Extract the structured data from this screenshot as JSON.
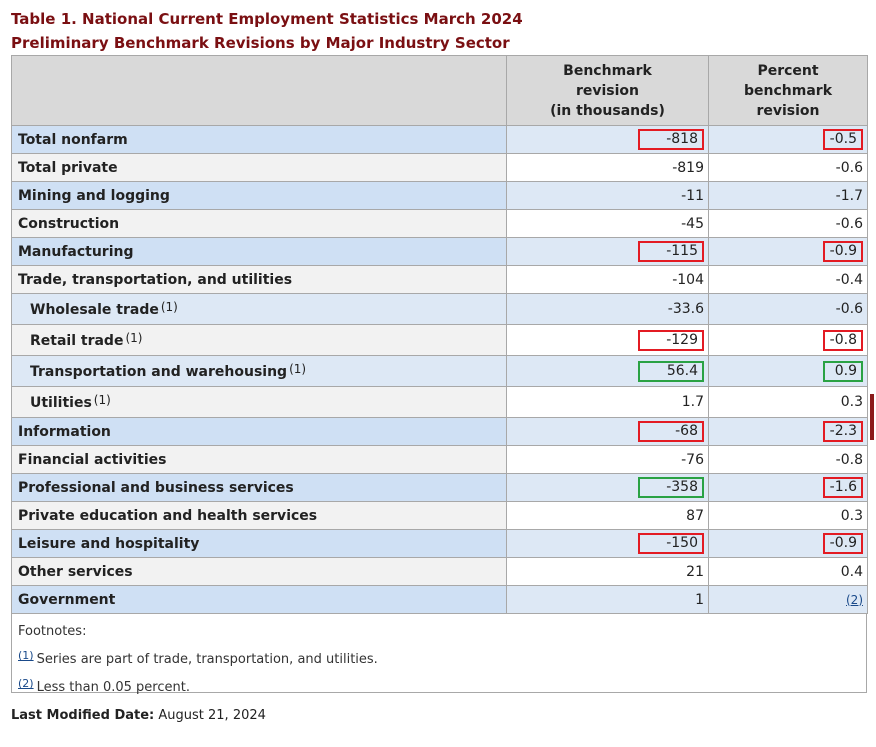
{
  "title": {
    "line1": "Table 1. National Current Employment Statistics March 2024",
    "line2": "Preliminary Benchmark Revisions by Major Industry Sector"
  },
  "columns": {
    "benchmark": [
      "Benchmark",
      "revision",
      "(in thousands)"
    ],
    "percent": [
      "Percent",
      "benchmark",
      "revision"
    ]
  },
  "rows": [
    {
      "label": "Total nonfarm",
      "benchmark": "-818",
      "percent": "-0.5",
      "bench_box": "red",
      "pct_box": "red"
    },
    {
      "label": "Total private",
      "benchmark": "-819",
      "percent": "-0.6"
    },
    {
      "label": "Mining and logging",
      "benchmark": "-11",
      "percent": "-1.7"
    },
    {
      "label": "Construction",
      "benchmark": "-45",
      "percent": "-0.6"
    },
    {
      "label": "Manufacturing",
      "benchmark": "-115",
      "percent": "-0.9",
      "bench_box": "red",
      "pct_box": "red"
    },
    {
      "label": "Trade, transportation, and utilities",
      "benchmark": "-104",
      "percent": "-0.4"
    },
    {
      "label": "Wholesale trade",
      "footnote": "(1)",
      "benchmark": "-33.6",
      "percent": "-0.6"
    },
    {
      "label": "Retail trade",
      "footnote": "(1)",
      "benchmark": "-129",
      "percent": "-0.8",
      "bench_box": "red",
      "pct_box": "red"
    },
    {
      "label": "Transportation and warehousing",
      "footnote": "(1)",
      "benchmark": "56.4",
      "percent": "0.9",
      "bench_box": "green",
      "pct_box": "green"
    },
    {
      "label": "Utilities",
      "footnote": "(1)",
      "benchmark": "1.7",
      "percent": "0.3"
    },
    {
      "label": "Information",
      "benchmark": "-68",
      "percent": "-2.3",
      "bench_box": "red",
      "pct_box": "red"
    },
    {
      "label": "Financial activities",
      "benchmark": "-76",
      "percent": "-0.8"
    },
    {
      "label": "Professional and business services",
      "benchmark": "-358",
      "percent": "-1.6",
      "bench_box": "green",
      "pct_box": "red"
    },
    {
      "label": "Private education and health services",
      "benchmark": "87",
      "percent": "0.3"
    },
    {
      "label": "Leisure and hospitality",
      "benchmark": "-150",
      "percent": "-0.9",
      "bench_box": "red",
      "pct_box": "red"
    },
    {
      "label": "Other services",
      "benchmark": "21",
      "percent": "0.4"
    },
    {
      "label": "Government",
      "benchmark": "1",
      "percent": "(2)"
    }
  ],
  "footnotes": {
    "heading": "Footnotes:",
    "items": [
      {
        "ref": "(1)",
        "text": "Series are part of trade, transportation, and utilities."
      },
      {
        "ref": "(2)",
        "text": "Less than 0.05 percent."
      }
    ]
  },
  "modified": {
    "label": "Last Modified Date:",
    "value": "August 21, 2024"
  },
  "colors": {
    "title": "#7a0f12",
    "stripe": "#dde8f5",
    "header": "#d9d9d9",
    "box_red": "#e31b23",
    "box_green": "#2aa244"
  }
}
